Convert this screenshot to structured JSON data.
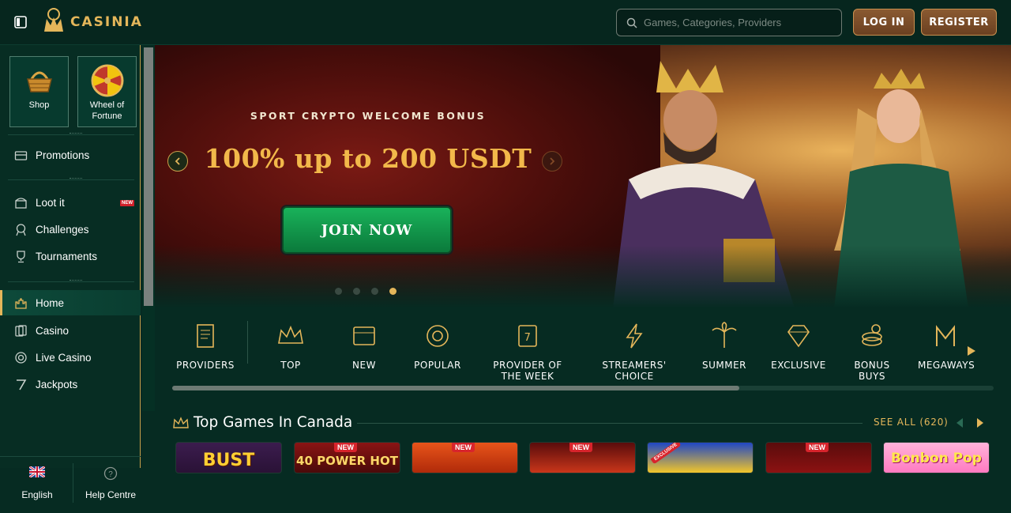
{
  "header": {
    "logo_text": "CASINIA",
    "search_placeholder": "Games, Categories, Providers",
    "login_label": "LOG IN",
    "register_label": "REGISTER"
  },
  "sidebar": {
    "tiles": [
      {
        "label": "Shop",
        "icon": "basket-icon"
      },
      {
        "label": "Wheel of Fortune",
        "icon": "wheel-icon"
      }
    ],
    "items": [
      {
        "label": "Promotions",
        "icon": "gift-icon"
      },
      {
        "label": "Loot it",
        "icon": "chest-icon",
        "badge": "NEW"
      },
      {
        "label": "Challenges",
        "icon": "badge-icon"
      },
      {
        "label": "Tournaments",
        "icon": "trophy-icon"
      },
      {
        "label": "Home",
        "icon": "castle-icon",
        "active": true
      },
      {
        "label": "Casino",
        "icon": "cards-icon"
      },
      {
        "label": "Live Casino",
        "icon": "chip-icon"
      },
      {
        "label": "Jackpots",
        "icon": "seven-icon"
      }
    ],
    "language": "English",
    "help": "Help Centre"
  },
  "hero": {
    "subtitle": "SPORT CRYPTO WELCOME BONUS",
    "title": "100% up to 200 USDT",
    "cta": "JOIN NOW",
    "slides": 4,
    "active_slide": 4
  },
  "categories": [
    {
      "label": "PROVIDERS",
      "icon": "scroll-icon"
    },
    {
      "label": "TOP",
      "icon": "crown-icon"
    },
    {
      "label": "NEW",
      "icon": "new-icon"
    },
    {
      "label": "POPULAR",
      "icon": "popular-icon"
    },
    {
      "label": "PROVIDER OF THE WEEK",
      "icon": "slot-icon"
    },
    {
      "label": "STREAMERS' CHOICE",
      "icon": "lightning-icon"
    },
    {
      "label": "SUMMER",
      "icon": "palm-icon"
    },
    {
      "label": "EXCLUSIVE",
      "icon": "diamond-icon"
    },
    {
      "label": "BONUS BUYS",
      "icon": "coins-icon"
    },
    {
      "label": "MEGAWAYS",
      "icon": "megaways-icon"
    }
  ],
  "top_games": {
    "title": "Top Games In Canada",
    "see_all": "SEE ALL (620)",
    "games": [
      {
        "title": "BUST",
        "badge": ""
      },
      {
        "title": "40 POWER HOT",
        "badge": "NEW"
      },
      {
        "title": "",
        "badge": "NEW"
      },
      {
        "title": "",
        "badge": "NEW"
      },
      {
        "title": "",
        "badge": "EXCLUSIVE"
      },
      {
        "title": "",
        "badge": "NEW"
      },
      {
        "title": "Bonbon Pop",
        "badge": ""
      }
    ]
  },
  "colors": {
    "accent": "#e4b65a",
    "bg": "#062b22",
    "cta_green": "#19b25a"
  }
}
